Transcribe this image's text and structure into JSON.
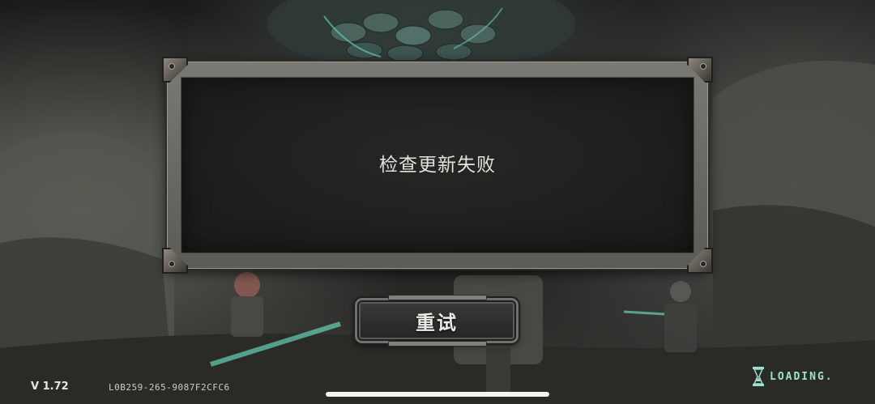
{
  "dialog": {
    "message": "检查更新失败",
    "retry_label": "重试"
  },
  "footer": {
    "version": "V 1.72",
    "build_id": "L0B259-265-9087F2CFC6",
    "loading_label": "LOADING."
  },
  "icons": {
    "loading": "hourglass-icon"
  },
  "colors": {
    "loading_accent": "#9fe0cf",
    "glow_accent": "#6fe3c6"
  }
}
